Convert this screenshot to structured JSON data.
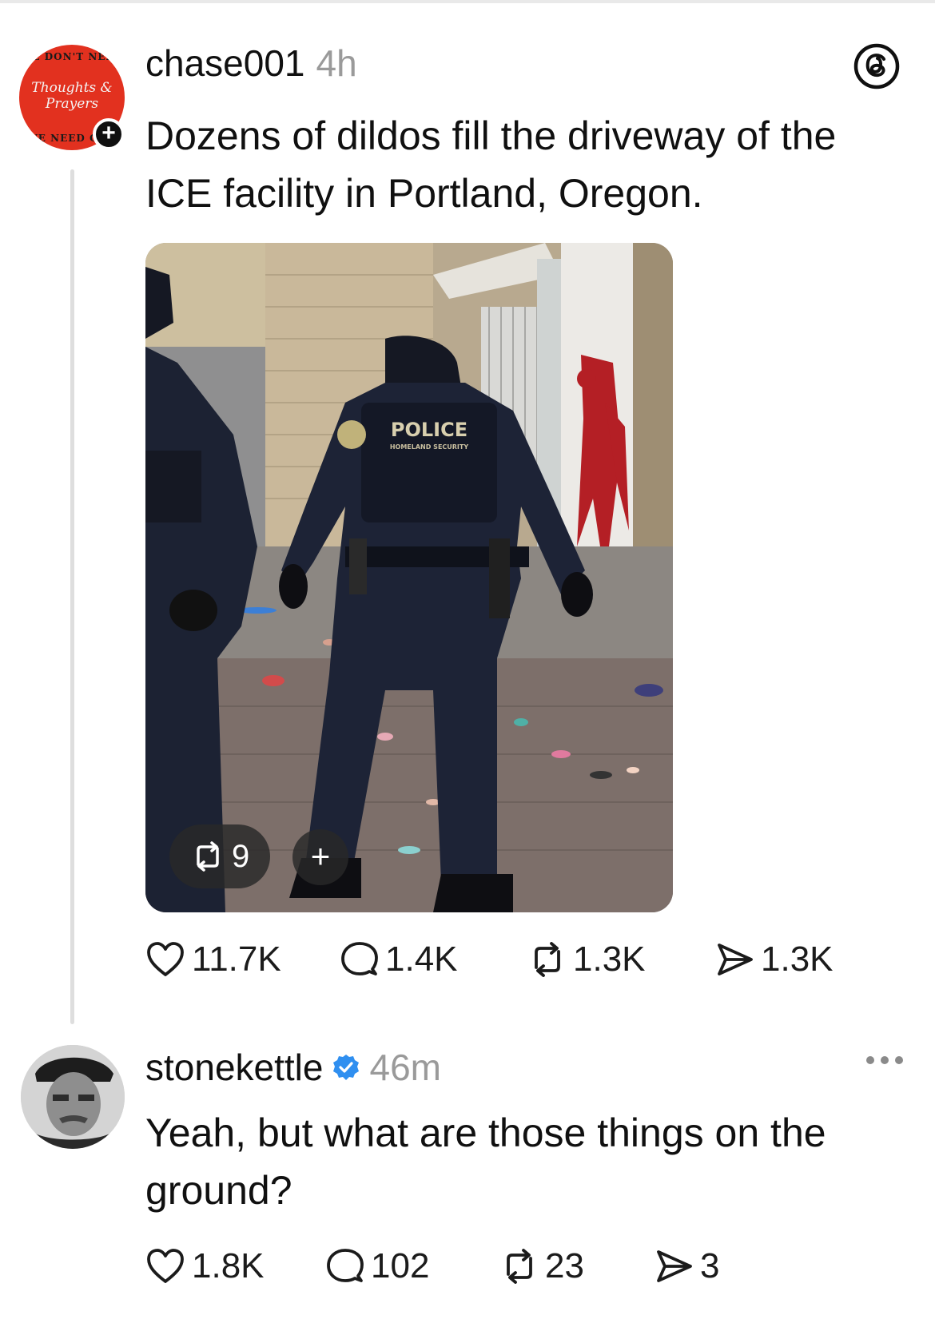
{
  "post": {
    "avatar_text_top": "WE DON'T NEED",
    "avatar_text_script": "Thoughts & Prayers",
    "avatar_text_bottom": "WE NEED GUN",
    "username": "chase001",
    "time": "4h",
    "text": "Dozens of dildos fill the driveway of the ICE facility in Portland, Oregon.",
    "image_vest_label": "POLICE",
    "image_vest_sublabel": "HOMELAND SECURITY",
    "image_repost_count": "9",
    "image_add_label": "+",
    "stats": {
      "likes": "11.7K",
      "comments": "1.4K",
      "reposts": "1.3K",
      "shares": "1.3K"
    }
  },
  "reply": {
    "username": "stonekettle",
    "time": "46m",
    "text": "Yeah, but what are those things on the ground?",
    "stats": {
      "likes": "1.8K",
      "comments": "102",
      "reposts": "23",
      "shares": "3"
    }
  },
  "icons": {
    "follow": "plus-icon",
    "app": "threads-logo-icon",
    "like": "heart-icon",
    "comment": "comment-bubble-icon",
    "repost": "repost-icon",
    "share": "share-send-icon",
    "verified": "verified-badge-icon",
    "more": "more-dots-icon"
  },
  "colors": {
    "verified": "#2f8ff0",
    "muted": "#9a9a9a",
    "text": "#101010",
    "avatar_red": "#e2311f"
  }
}
